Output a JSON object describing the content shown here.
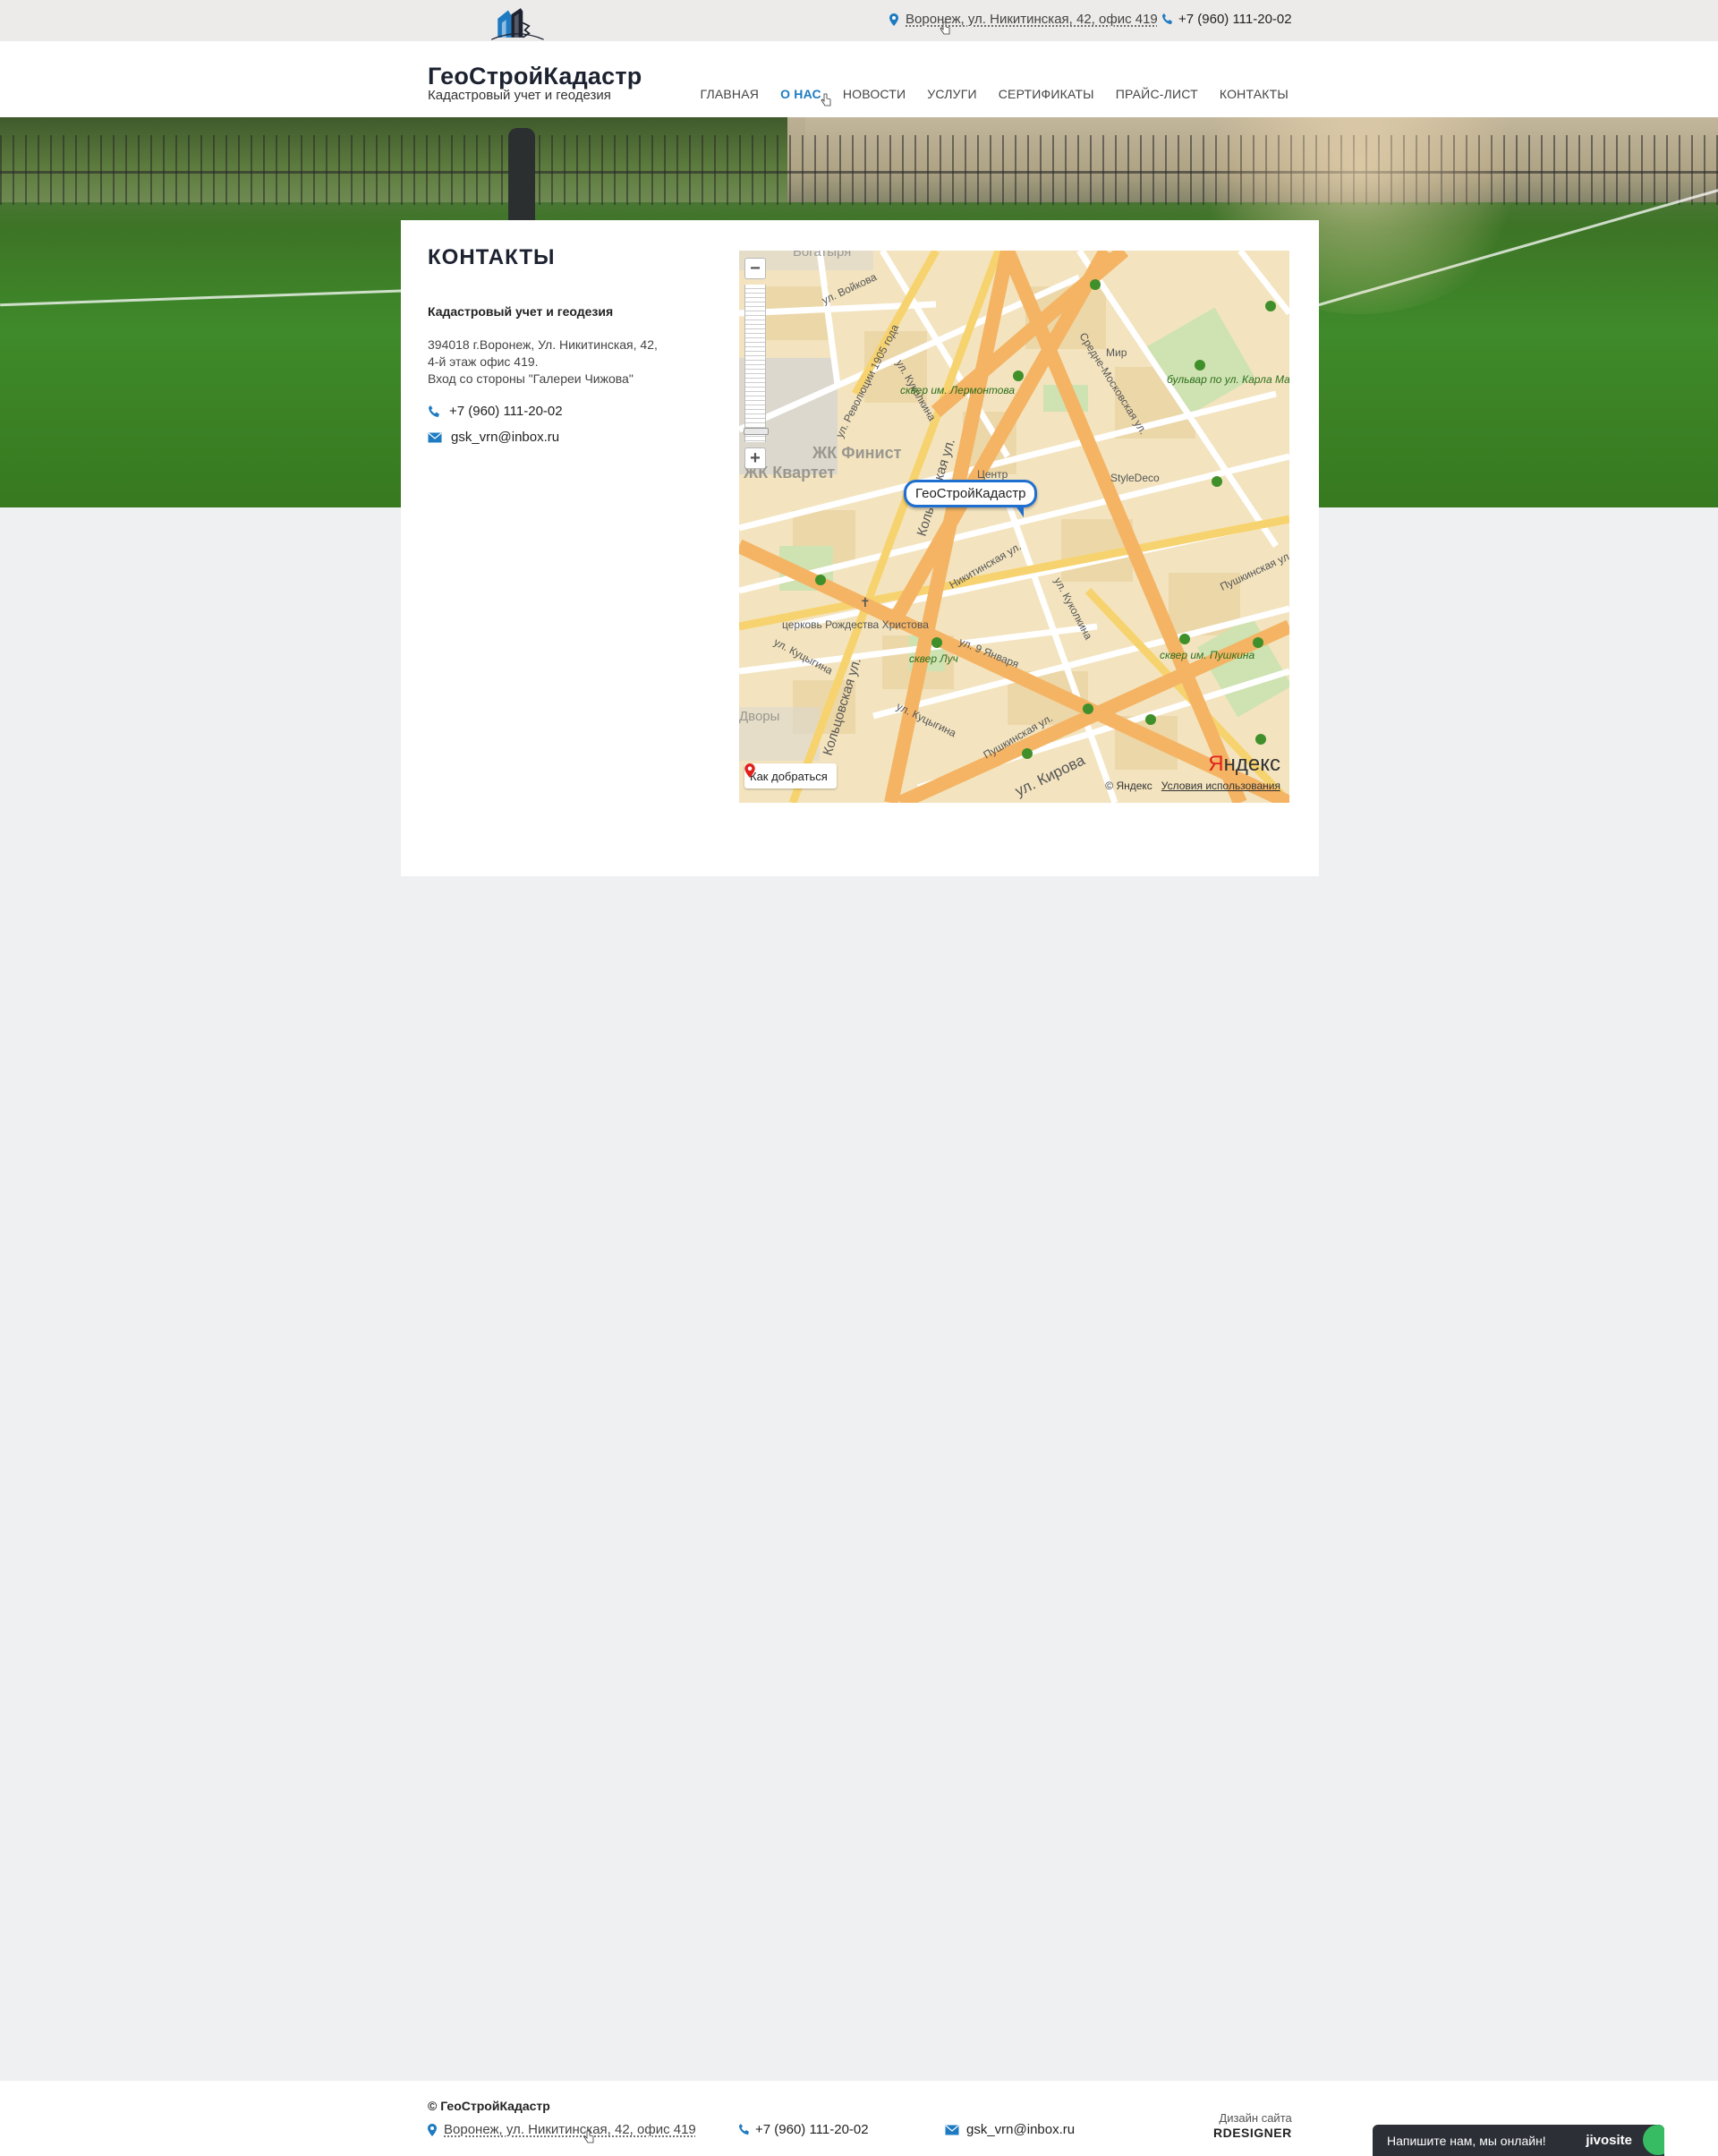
{
  "topbar": {
    "address": "Воронеж, ул. Никитинская, 42, офис 419",
    "phone": "+7 (960) 111-20-02"
  },
  "logo": {
    "name": "ГеоСтройКадастр",
    "subtitle": "Кадастровый учет и геодезия"
  },
  "nav": {
    "items": [
      {
        "label": "ГЛАВНАЯ",
        "active": false
      },
      {
        "label": "О НАС",
        "active": true
      },
      {
        "label": "НОВОСТИ",
        "active": false
      },
      {
        "label": "УСЛУГИ",
        "active": false
      },
      {
        "label": "СЕРТИФИКАТЫ",
        "active": false
      },
      {
        "label": "ПРАЙС-ЛИСТ",
        "active": false
      },
      {
        "label": "КОНТАКТЫ",
        "active": false
      }
    ]
  },
  "contacts": {
    "title": "КОНТАКТЫ",
    "company": "Кадастровый учет и геодезия",
    "address_line1": "394018 г.Воронеж, Ул. Никитинская, 42,",
    "address_line2": "4-й этаж офис 419.",
    "address_line3": "Вход со стороны \"Галереи Чижова\"",
    "phone": "+7 (960) 111-20-02",
    "email": "gsk_vrn@inbox.ru"
  },
  "map": {
    "placemark": "ГеоСтройКадастр",
    "route_label": "Как добраться",
    "copyright": "© Яндекс",
    "terms": "Условия использования",
    "logo_red": "Я",
    "logo_rest": "ндекс",
    "labels": {
      "bogatyrya": "Богатыря",
      "voykova": "ул. Войкова",
      "revolyutsii": "ул. Революции 1905 года",
      "kukolkina": "ул. Куколкина",
      "koltsovskaya": "Кольцовская ул.",
      "koltsovskaya2": "Кольцовская ул.",
      "sredne": "Средне-Московская ул.",
      "mir": "Мир",
      "lermontova": "сквер им. Лермонтова",
      "marksa": "бульвар по ул. Карла Маркса",
      "finist": "ЖК Финист",
      "kvartet": "ЖК Квартет",
      "tsentr": "Центр",
      "styledeco": "StyleDeco",
      "nikitinskaya": "Никитинская ул.",
      "kukolkina2": "ул. Куколкина",
      "pushkinskaya": "Пушкинская ул.",
      "pushkinskaya2": "Пушкинская ул.",
      "tserkov": "церковь Рождества Христова",
      "kutsygina": "ул. Куцыгина",
      "kutsygina2": "ул. Куцыгина",
      "luch": "сквер Луч",
      "yanvarya": "ул. 9 Января",
      "pushkina": "сквер им. Пушкина",
      "dvory": "Дворы",
      "kirova": "ул. Кирова"
    }
  },
  "footer": {
    "copyright": "© ГеоСтройКадастр",
    "address": "Воронеж, ул. Никитинская, 42, офис 419",
    "phone": "+7 (960) 111-20-02",
    "email": "gsk_vrn@inbox.ru",
    "design_label": "Дизайн сайта",
    "design_brand": "RDESIGNER"
  },
  "chat": {
    "text": "Напишите нам, мы онлайн!",
    "brand": "jivosite"
  },
  "colors": {
    "accent": "#1e7bc2",
    "page_bg": "#eff0f2",
    "topbar_bg": "#ecebe9",
    "logo_dark": "#1c2230",
    "map_bg": "#f4e6c2",
    "chat_bg": "#2c2f36",
    "chat_dot": "#37bb63"
  },
  "icons": {
    "location": "map-pin-icon",
    "phone": "phone-icon",
    "mail": "envelope-icon",
    "route": "red-pin-icon"
  }
}
